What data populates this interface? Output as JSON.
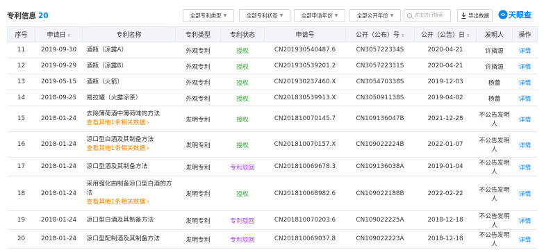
{
  "header": {
    "title": "专利信息",
    "count": "20",
    "filters": [
      "全部专利类型",
      "全部专利状态",
      "全部申请年份",
      "全部公开年份"
    ],
    "search_placeholder": "点击进行搜索",
    "export_label": "导出数据",
    "logo_text": "天眼查"
  },
  "colors": {
    "accent": "#0084ff",
    "granted": "#2aa82a",
    "rejected": "#9b3fe0",
    "more_link": "#f08300",
    "header_bg": "#f2f5fa"
  },
  "table": {
    "columns": [
      "序号",
      "申请日",
      "专利名称",
      "专利类型",
      "专利状态",
      "申请号",
      "公开（公布）号",
      "公开（公告）日",
      "发明人",
      "操作"
    ],
    "rows": [
      {
        "no": "11",
        "date": "2019-09-30",
        "name": "酒瓶（凉露A）",
        "more": "",
        "type": "外观专利",
        "status": "授权",
        "status_kind": "grant",
        "app_no": "CN201930540487.6",
        "pub_no": "CN305722334S",
        "pub_date": "2020-04-21",
        "inventor": "许旖源",
        "action": "详情"
      },
      {
        "no": "12",
        "date": "2019-09-29",
        "name": "酒瓶（凉露B）",
        "more": "",
        "type": "外观专利",
        "status": "授权",
        "status_kind": "grant",
        "app_no": "CN201930539201.2",
        "pub_no": "CN305722331S",
        "pub_date": "2020-04-21",
        "inventor": "许旖源",
        "action": "详情"
      },
      {
        "no": "13",
        "date": "2019-05-15",
        "name": "酒瓶（火箭）",
        "more": "",
        "type": "外观专利",
        "status": "授权",
        "status_kind": "grant",
        "app_no": "CN201930237460.X",
        "pub_no": "CN305470338S",
        "pub_date": "2019-12-03",
        "inventor": "杨蕾",
        "action": "详情"
      },
      {
        "no": "14",
        "date": "2018-09-25",
        "name": "易拉罐（火露凉茶）",
        "more": "",
        "type": "外观专利",
        "status": "授权",
        "status_kind": "grant",
        "app_no": "CN201830539913.X",
        "pub_no": "CN305091138S",
        "pub_date": "2019-04-02",
        "inventor": "杨蕾",
        "action": "详情"
      },
      {
        "no": "15",
        "date": "2018-01-24",
        "name": "去除薄荷酒中薄荷味的方法",
        "more": "查看其他1条相关数据",
        "type": "发明专利",
        "status": "授权",
        "status_kind": "grant",
        "app_no": "CN201810070145.7",
        "pub_no": "CN109136047B",
        "pub_date": "2021-12-28",
        "inventor": "不公告发明人",
        "action": "详情"
      },
      {
        "no": "16",
        "date": "2018-01-24",
        "name": "凉口型白酒及其制备方法",
        "more": "查看其他1条相关数据",
        "type": "发明专利",
        "status": "授权",
        "status_kind": "grant",
        "app_no": "CN201810070157.X",
        "pub_no": "CN109022224B",
        "pub_date": "2022-01-07",
        "inventor": "不公告发明人",
        "action": "详情"
      },
      {
        "no": "17",
        "date": "2018-01-24",
        "name": "凉口型酒及其制备方法",
        "more": "",
        "type": "发明专利",
        "status": "专利驳回",
        "status_kind": "reject",
        "app_no": "CN201810069678.3",
        "pub_no": "CN109136038A",
        "pub_date": "2019-01-04",
        "inventor": "不公告发明人",
        "action": "详情"
      },
      {
        "no": "18",
        "date": "2018-01-24",
        "name": "采用强化曲制备凉口型白酒的方法",
        "more": "查看其他1条相关数据",
        "type": "发明专利",
        "status": "授权",
        "status_kind": "grant",
        "app_no": "CN201810068982.6",
        "pub_no": "CN109022188B",
        "pub_date": "2022-02-22",
        "inventor": "不公告发明人",
        "action": "详情"
      },
      {
        "no": "19",
        "date": "2018-01-24",
        "name": "凉口型白酒及其制备方法",
        "more": "",
        "type": "发明专利",
        "status": "专利驳回",
        "status_kind": "reject",
        "app_no": "CN201810070203.6",
        "pub_no": "CN109022225A",
        "pub_date": "2018-12-18",
        "inventor": "不公告发明人",
        "action": "详情"
      },
      {
        "no": "20",
        "date": "2018-01-24",
        "name": "凉口型配制酒及其制备方法",
        "more": "",
        "type": "发明专利",
        "status": "专利驳回",
        "status_kind": "reject",
        "app_no": "CN201810069037.8",
        "pub_no": "CN109022223A",
        "pub_date": "2018-12-18",
        "inventor": "不公告发明人",
        "action": "详情"
      }
    ]
  }
}
